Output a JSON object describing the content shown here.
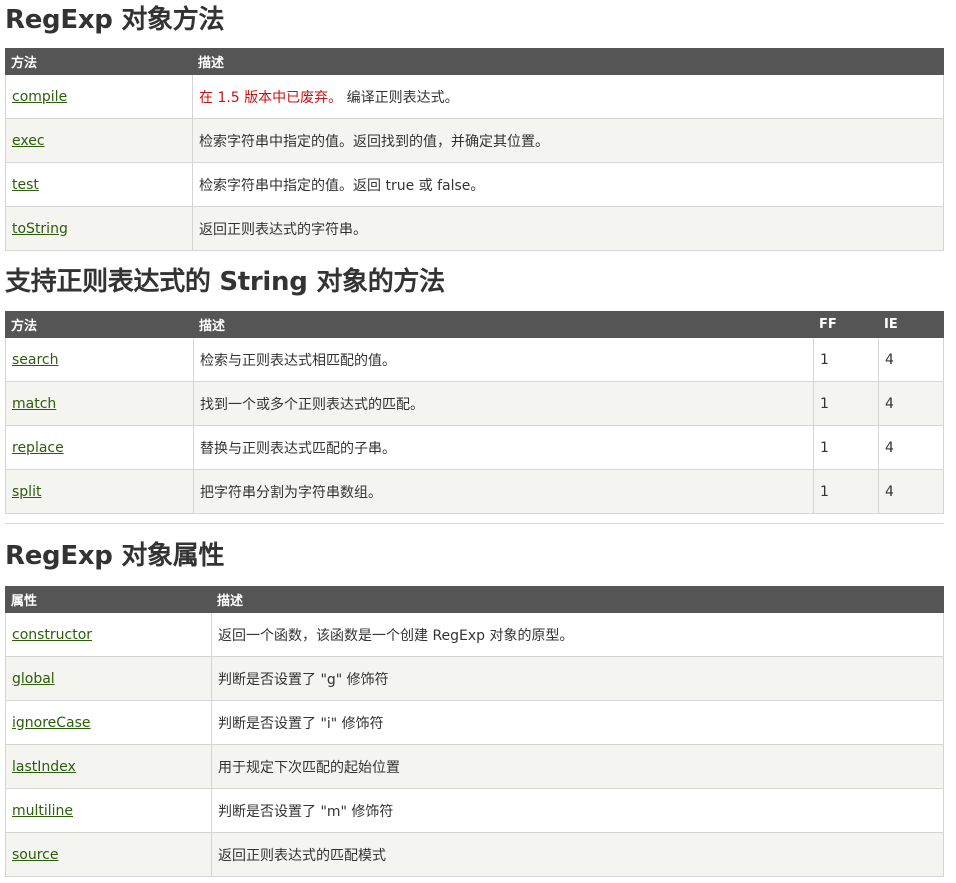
{
  "sections": [
    {
      "title": "RegExp 对象方法",
      "headers": [
        "方法",
        "描述"
      ],
      "rows": [
        {
          "name": "compile",
          "desc_deprecated": "在 1.5 版本中已废弃。",
          "desc": "编译正则表达式。"
        },
        {
          "name": "exec",
          "desc": "检索字符串中指定的值。返回找到的值，并确定其位置。"
        },
        {
          "name": "test",
          "desc": "检索字符串中指定的值。返回 true 或 false。"
        },
        {
          "name": "toString",
          "desc": "返回正则表达式的字符串。"
        }
      ]
    },
    {
      "title": "支持正则表达式的 String 对象的方法",
      "headers": [
        "方法",
        "描述",
        "FF",
        "IE"
      ],
      "rows": [
        {
          "name": "search",
          "desc": "检索与正则表达式相匹配的值。",
          "ff": "1",
          "ie": "4"
        },
        {
          "name": "match",
          "desc": "找到一个或多个正则表达式的匹配。",
          "ff": "1",
          "ie": "4"
        },
        {
          "name": "replace",
          "desc": "替换与正则表达式匹配的子串。",
          "ff": "1",
          "ie": "4"
        },
        {
          "name": "split",
          "desc": "把字符串分割为字符串数组。",
          "ff": "1",
          "ie": "4"
        }
      ]
    },
    {
      "title": "RegExp 对象属性",
      "headers": [
        "属性",
        "描述"
      ],
      "rows": [
        {
          "name": "constructor",
          "desc": "返回一个函数，该函数是一个创建 RegExp 对象的原型。"
        },
        {
          "name": "global",
          "desc": "判断是否设置了 \"g\" 修饰符"
        },
        {
          "name": "ignoreCase",
          "desc": "判断是否设置了 \"i\" 修饰符"
        },
        {
          "name": "lastIndex",
          "desc": "用于规定下次匹配的起始位置"
        },
        {
          "name": "multiline",
          "desc": "判断是否设置了 \"m\" 修饰符"
        },
        {
          "name": "source",
          "desc": "返回正则表达式的匹配模式"
        }
      ]
    }
  ]
}
